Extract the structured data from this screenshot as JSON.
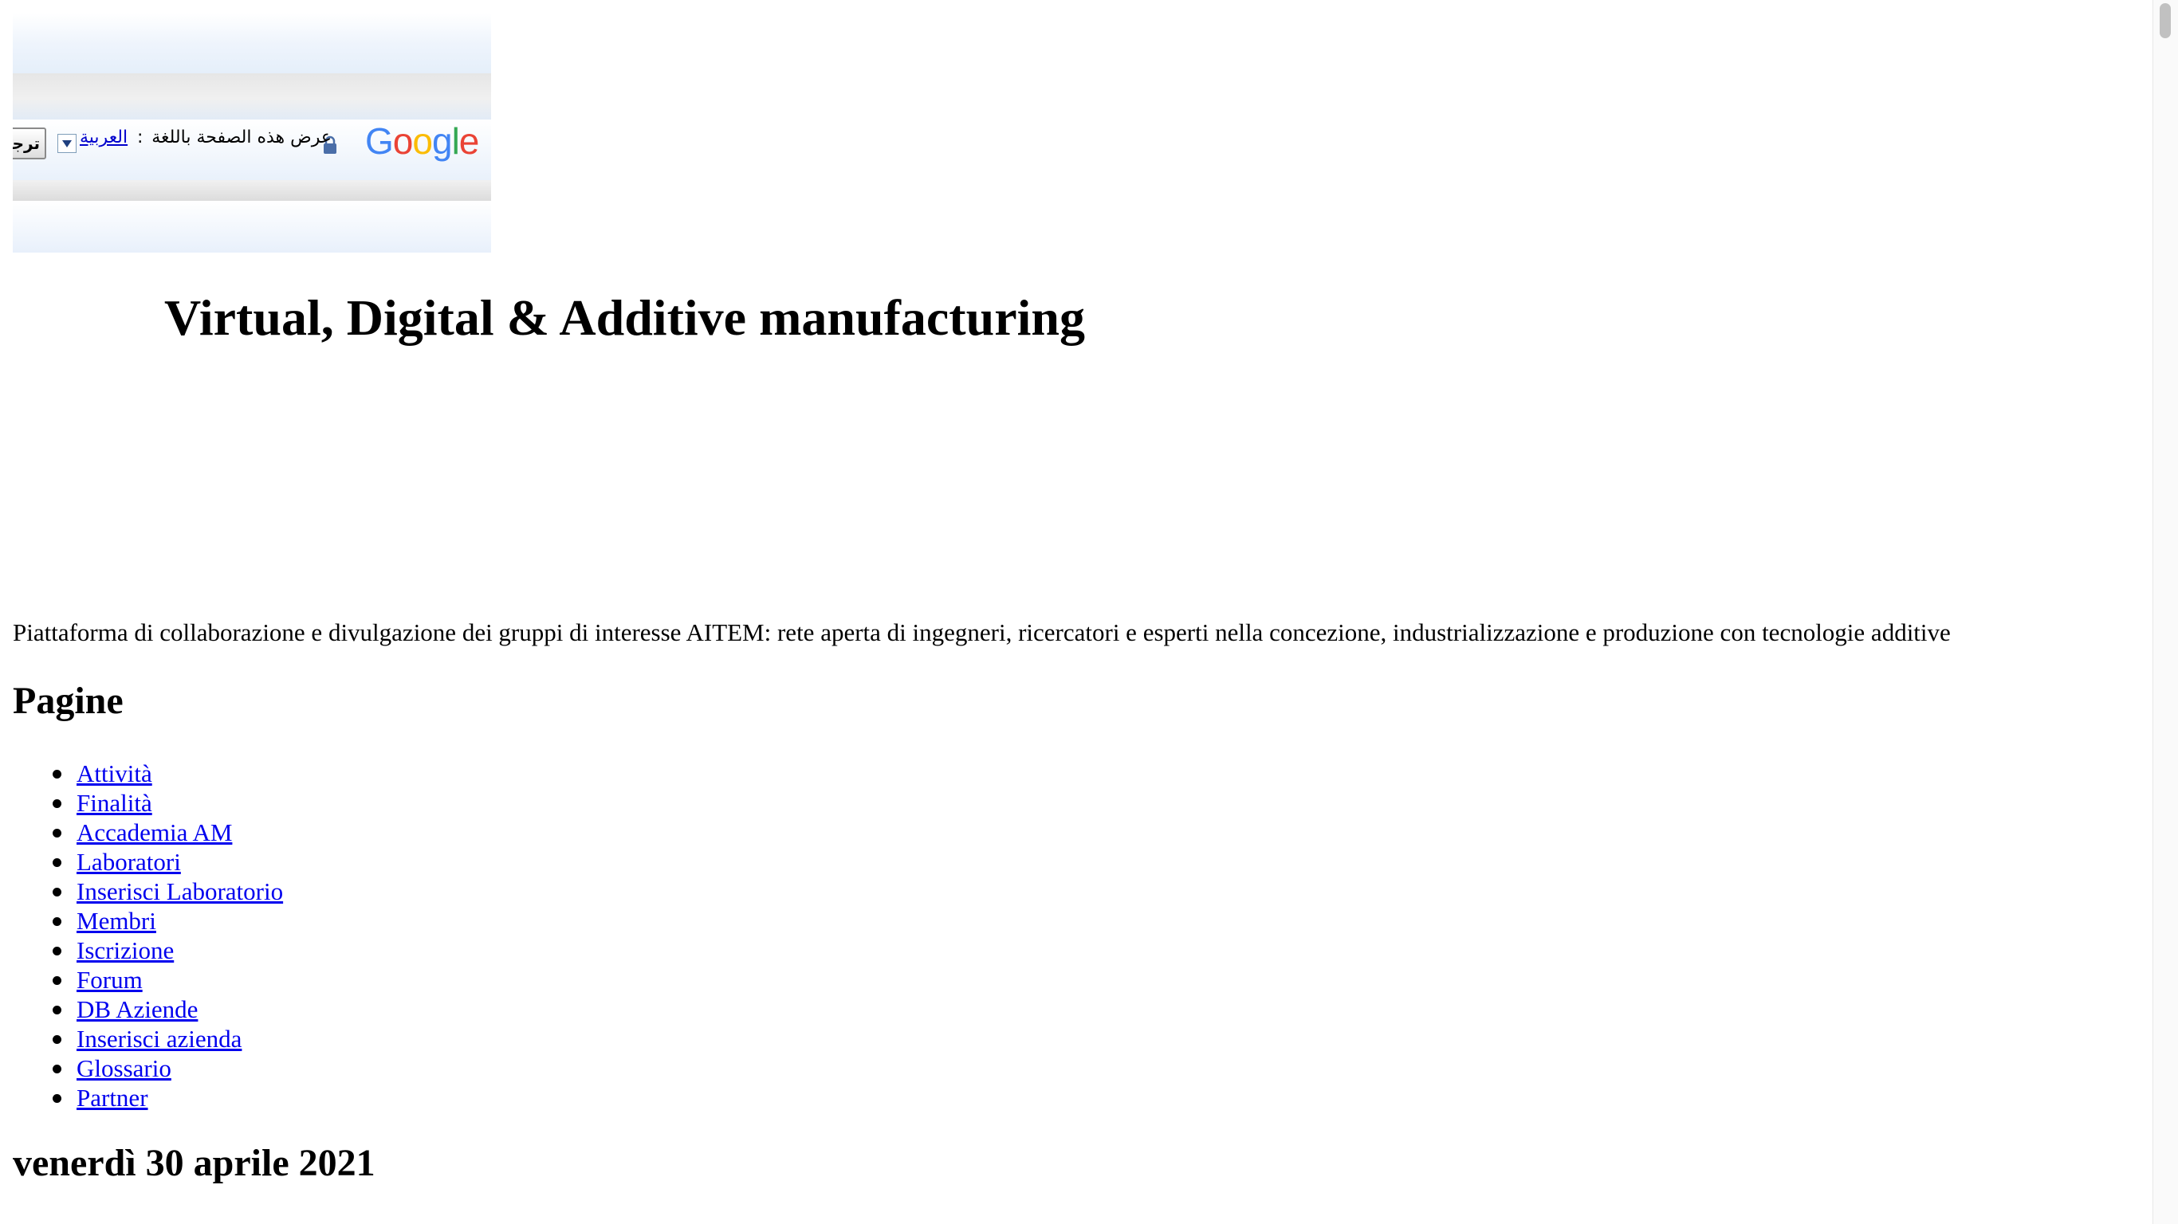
{
  "translate_bar": {
    "logo_text": [
      "G",
      "o",
      "o",
      "g",
      "l",
      "e"
    ],
    "prompt_text": "عرض هذه الصفحة باللغة",
    "colon": ":",
    "language": "العربية",
    "button_label": "ترجمة"
  },
  "header": {
    "title": "Virtual, Digital & Additive manufacturing",
    "description": "Piattaforma di collaborazione e divulgazione dei gruppi di interesse AITEM: rete aperta di ingegneri, ricercatori e esperti nella concezione, industrializzazione e produzione con tecnologie additive"
  },
  "pages": {
    "heading": "Pagine",
    "items": [
      {
        "label": "Attività"
      },
      {
        "label": "Finalità"
      },
      {
        "label": "Accademia AM"
      },
      {
        "label": "Laboratori"
      },
      {
        "label": "Inserisci Laboratorio"
      },
      {
        "label": "Membri"
      },
      {
        "label": "Iscrizione"
      },
      {
        "label": "Forum"
      },
      {
        "label": "DB Aziende"
      },
      {
        "label": "Inserisci azienda"
      },
      {
        "label": "Glossario"
      },
      {
        "label": "Partner"
      }
    ]
  },
  "post": {
    "date": "venerdì 30 aprile 2021"
  },
  "colors": {
    "link": "#0000ee",
    "text": "#000000",
    "background": "#ffffff"
  }
}
